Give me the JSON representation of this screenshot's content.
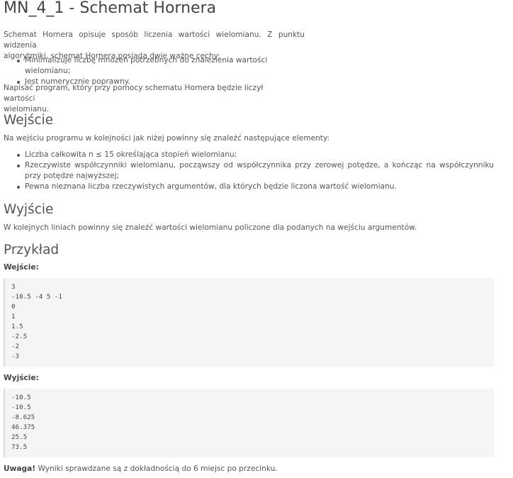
{
  "title": "MN_4_1 - Schemat Hornera",
  "intro": {
    "paragraph_line1": "Schemat Hornera opisuje sposób liczenia wartości wielomianu. Z punktu widzenia",
    "paragraph_line2": "algorytmiki, schemat Hornera posiada dwie ważne cechy:",
    "features": [
      "Minimalizuje liczbę mnożeń potrzebnych do znalezienia wartości wielomianu;",
      "Jest numerycznie poprawny."
    ],
    "task_line1": "Napisać program, który przy pomocy schematu Hornera będzie liczył wartości",
    "task_line2": "wielomianu."
  },
  "input_section": {
    "heading": "Wejście",
    "description": "Na wejściu programu w kolejności jak niżej powinny się znaleźć następujące elementy:",
    "items": [
      "Liczba całkowita n ≤ 15 określająca stopień wielomianu;",
      "Rzeczywiste współczynniki wielomianu, począwszy od współczynnika przy zerowej potędze, a kończąc na współczynniku przy potędze najwyższej;",
      "Pewna nieznana liczba rzeczywistych argumentów, dla których będzie liczona wartość wielomianu."
    ]
  },
  "output_section": {
    "heading": "Wyjście",
    "description": "W kolejnych liniach powinny się znaleźć wartości wielomianu policzone dla podanych na wejściu argumentów."
  },
  "example": {
    "heading": "Przykład",
    "input_label": "Wejście:",
    "input_code": "3\n-10.5 -4 5 -1\n0\n1\n1.5\n-2.5\n-2\n-3",
    "output_label": "Wyjście:",
    "output_code": "-10.5\n-10.5\n-8.625\n46.375\n25.5\n73.5"
  },
  "note": {
    "label": "Uwaga!",
    "text": " Wyniki sprawdzane są z dokładnością do 6 miejsc po przecinku."
  }
}
